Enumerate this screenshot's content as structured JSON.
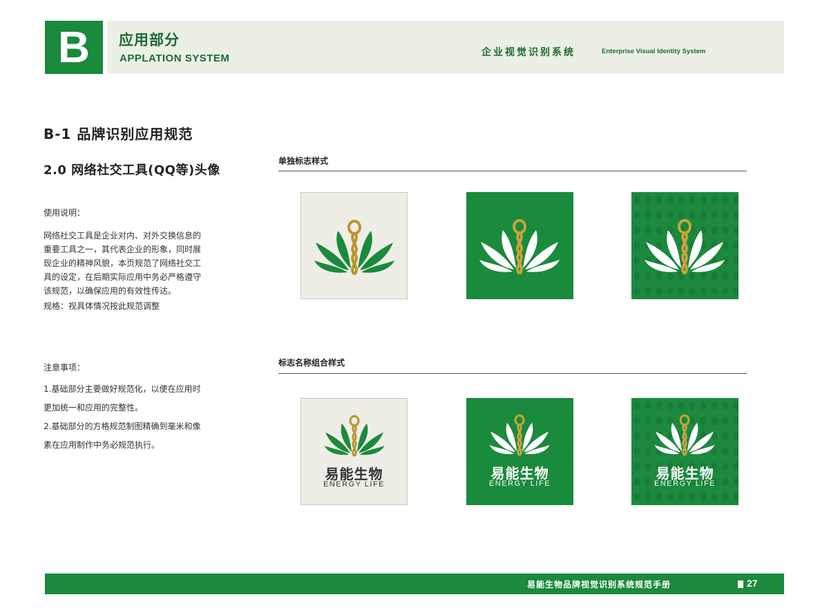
{
  "header": {
    "section_letter": "B",
    "section_title_cn": "应用部分",
    "section_title_en": "APPLATION SYSTEM",
    "system_title_cn": "企业视觉识别系统",
    "system_title_en": "Enterprise Visual Identity System"
  },
  "content": {
    "page_heading": "B-1 品牌识别应用规范",
    "sub_heading": "2.0 网络社交工具(QQ等)头像",
    "usage_label": "使用说明：",
    "usage_lines": [
      "网络社交工具是企业对内、对外交换信息的",
      "重要工具之一，其代表企业的形象，同时展",
      "现企业的精神风貌，本页规范了网络社交工",
      "具的设定，在后期实际应用中务必严格遵守",
      "该规范，以确保应用的有效性传达。"
    ],
    "spec_text": "规格：视具体情况按此规范调整",
    "notes_label": "注意事项：",
    "notes_lines": [
      "1.基础部分主要做好规范化，以便在应用时",
      "更加统一和应用的完整性。",
      "2.基础部分的方格规范制图精确到毫米和像",
      "素在应用制作中务必规范执行。"
    ]
  },
  "groups": {
    "logo_only_title": "单独标志样式",
    "logo_name_title": "标志名称组合样式"
  },
  "brand": {
    "name_cn": "易能生物",
    "name_en": "ENERGY LIFE"
  },
  "colors": {
    "brand_green": "#1a8a3c",
    "gold": "#b8962e",
    "light_tile": "#eeeee6"
  },
  "footer": {
    "manual_title": "易能生物品牌视觉识别系统规范手册",
    "page_number": "27"
  }
}
